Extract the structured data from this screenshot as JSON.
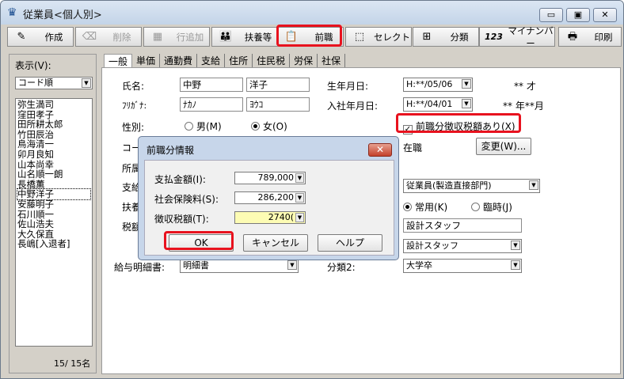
{
  "window": {
    "title": "従業員<個人別>",
    "min": "▭",
    "max": "▣",
    "close": "✕"
  },
  "toolbar": [
    {
      "label": "作成",
      "icon": "create-icon",
      "glyph": "✎",
      "enabled": true
    },
    {
      "label": "削除",
      "icon": "delete-icon",
      "glyph": "⌫",
      "enabled": false
    },
    {
      "label": "行追加",
      "icon": "add-row-icon",
      "glyph": "▦",
      "enabled": false
    },
    {
      "label": "扶養等",
      "icon": "family-icon",
      "glyph": "👪",
      "enabled": true
    },
    {
      "label": "前職",
      "icon": "previous-job-icon",
      "glyph": "📋",
      "enabled": true
    },
    {
      "label": "セレクト",
      "icon": "select-icon",
      "glyph": "⬚",
      "enabled": true
    },
    {
      "label": "分類",
      "icon": "classify-icon",
      "glyph": "⊞",
      "enabled": true
    },
    {
      "label": "マイナンバー",
      "icon": "mynumber-icon",
      "glyph": "123",
      "enabled": true
    },
    {
      "label": "印刷",
      "icon": "print-icon",
      "glyph": "🖶",
      "enabled": true
    }
  ],
  "left": {
    "display_label": "表示(V):",
    "sort_value": "コード順",
    "names": [
      "弥生満司",
      "窪田孝子",
      "田所耕太郎",
      "竹田辰治",
      "鳥海清一",
      "卯月良知",
      "山本尚幸",
      "山名順一朗",
      "長橋薫",
      "中野洋子",
      "安藤明子",
      "石川順一",
      "佐山浩夫",
      "大久保直",
      "長嶋[入退者]"
    ],
    "selected_index": 9,
    "count": "15/  15名"
  },
  "tabs": [
    "一般",
    "単価",
    "通勤費",
    "支給",
    "住所",
    "住民税",
    "労保",
    "社保"
  ],
  "form": {
    "name_label": "氏名:",
    "last_name": "中野",
    "first_name": "洋子",
    "kana_label": "ﾌﾘｶﾞﾅ:",
    "last_kana": "ﾅｶﾉ",
    "first_kana": "ﾖｳｺ",
    "gender_label": "性別:",
    "male": "男(M)",
    "female": "女(O)",
    "birth_label": "生年月日:",
    "birth_value": "H:**/05/06",
    "age": "** 才",
    "hire_label": "入社年月日:",
    "hire_value": "H:**/04/01",
    "tenure": "** 年**月",
    "prev_tax_check": "前職分徴収税額あり(X)",
    "code_label": "コー",
    "dept_label": "所属",
    "pay_label": "支給",
    "support_label": "扶養",
    "tax_label": "税額",
    "status_label": "在職",
    "change_button": "変更(W)...",
    "employee_type": "従業員(製造直接部門)",
    "regular": "常用(K)",
    "temporary": "臨時(J)",
    "job1": "設計スタッフ",
    "job2": "設計スタッフ",
    "payslip_label": "給与明細書:",
    "payslip_value": "明細書",
    "cat2_label": "分類2:",
    "cat2_value": "大学卒"
  },
  "dialog": {
    "title": "前職分情報",
    "close": "✕",
    "paid_label": "支払金額(I):",
    "paid_value": "789,000",
    "insurance_label": "社会保険料(S):",
    "insurance_value": "286,200",
    "tax_label": "徴収税額(T):",
    "tax_value": "2740(",
    "ok": "OK",
    "cancel": "キャンセル",
    "help": "ヘルプ"
  }
}
